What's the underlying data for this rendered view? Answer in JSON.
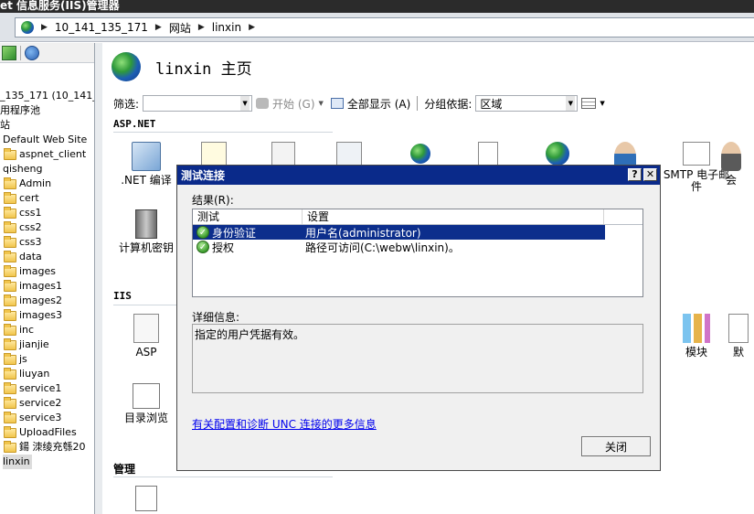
{
  "window": {
    "title": "et 信息服务(IIS)管理器"
  },
  "address": {
    "segments": [
      "10_141_135_171",
      "网站",
      "linxin"
    ]
  },
  "tree": {
    "items": [
      {
        "label": "_135_171 (10_141_",
        "type": "server"
      },
      {
        "label": "用程序池",
        "type": "node"
      },
      {
        "label": "站",
        "type": "node"
      },
      {
        "label": "Default Web Site",
        "type": "site"
      },
      {
        "label": "aspnet_client",
        "type": "folder"
      },
      {
        "label": "qisheng",
        "type": "site"
      },
      {
        "label": "Admin",
        "type": "folder"
      },
      {
        "label": "cert",
        "type": "folder"
      },
      {
        "label": "css1",
        "type": "folder"
      },
      {
        "label": "css2",
        "type": "folder"
      },
      {
        "label": "css3",
        "type": "folder"
      },
      {
        "label": "data",
        "type": "folder"
      },
      {
        "label": "images",
        "type": "folder"
      },
      {
        "label": "images1",
        "type": "folder"
      },
      {
        "label": "images2",
        "type": "folder"
      },
      {
        "label": "images3",
        "type": "folder"
      },
      {
        "label": "inc",
        "type": "folder"
      },
      {
        "label": "jianjie",
        "type": "folder"
      },
      {
        "label": "js",
        "type": "folder"
      },
      {
        "label": "liuyan",
        "type": "folder"
      },
      {
        "label": "service1",
        "type": "folder"
      },
      {
        "label": "service2",
        "type": "folder"
      },
      {
        "label": "service3",
        "type": "folder"
      },
      {
        "label": "UploadFiles",
        "type": "folder"
      },
      {
        "label": "鍚   洓绫充綔20",
        "type": "folder"
      },
      {
        "label": "linxin",
        "type": "site"
      }
    ]
  },
  "main": {
    "title": "linxin 主页",
    "filter": {
      "label": "筛选:",
      "start_label": "开始 (G)",
      "show_all_label": "全部显示 (A)",
      "group_label": "分组依据:",
      "group_value": "区域"
    },
    "sections": {
      "aspnet": "ASP.NET",
      "iis": "IIS",
      "manage": "管理"
    },
    "features": {
      "net_compile": ".NET 编译",
      "machine_key": "计算机密钥",
      "asp": "ASP",
      "dir_browse": "目录浏览",
      "smtp": "SMTP 电子邮件",
      "hui": "会",
      "modules": "模块",
      "mo": "默"
    }
  },
  "dialog": {
    "title": "测试连接",
    "help": "?",
    "close_x": "✕",
    "results_label": "结果(R):",
    "columns": [
      "测试",
      "设置"
    ],
    "rows": [
      {
        "test": "身份验证",
        "setting": "用户名(administrator)",
        "status": "pass"
      },
      {
        "test": "授权",
        "setting": "路径可访问(C:\\webw\\linxin)。",
        "status": "pass"
      }
    ],
    "details_label": "详细信息:",
    "details_text": "指定的用户凭据有效。",
    "link_text": "有关配置和诊断 UNC 连接的更多信息",
    "close_button": "关闭"
  }
}
